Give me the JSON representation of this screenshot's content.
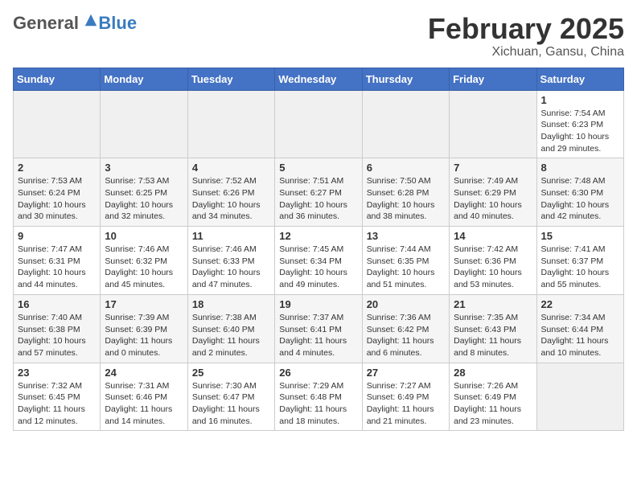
{
  "header": {
    "logo_general": "General",
    "logo_blue": "Blue",
    "month_title": "February 2025",
    "subtitle": "Xichuan, Gansu, China"
  },
  "days_of_week": [
    "Sunday",
    "Monday",
    "Tuesday",
    "Wednesday",
    "Thursday",
    "Friday",
    "Saturday"
  ],
  "weeks": [
    [
      {
        "day": "",
        "empty": true
      },
      {
        "day": "",
        "empty": true
      },
      {
        "day": "",
        "empty": true
      },
      {
        "day": "",
        "empty": true
      },
      {
        "day": "",
        "empty": true
      },
      {
        "day": "",
        "empty": true
      },
      {
        "day": "1",
        "sunrise": "7:54 AM",
        "sunset": "6:23 PM",
        "daylight": "10 hours and 29 minutes."
      }
    ],
    [
      {
        "day": "2",
        "sunrise": "7:53 AM",
        "sunset": "6:24 PM",
        "daylight": "10 hours and 30 minutes."
      },
      {
        "day": "3",
        "sunrise": "7:53 AM",
        "sunset": "6:25 PM",
        "daylight": "10 hours and 32 minutes."
      },
      {
        "day": "4",
        "sunrise": "7:52 AM",
        "sunset": "6:26 PM",
        "daylight": "10 hours and 34 minutes."
      },
      {
        "day": "5",
        "sunrise": "7:51 AM",
        "sunset": "6:27 PM",
        "daylight": "10 hours and 36 minutes."
      },
      {
        "day": "6",
        "sunrise": "7:50 AM",
        "sunset": "6:28 PM",
        "daylight": "10 hours and 38 minutes."
      },
      {
        "day": "7",
        "sunrise": "7:49 AM",
        "sunset": "6:29 PM",
        "daylight": "10 hours and 40 minutes."
      },
      {
        "day": "8",
        "sunrise": "7:48 AM",
        "sunset": "6:30 PM",
        "daylight": "10 hours and 42 minutes."
      }
    ],
    [
      {
        "day": "9",
        "sunrise": "7:47 AM",
        "sunset": "6:31 PM",
        "daylight": "10 hours and 44 minutes."
      },
      {
        "day": "10",
        "sunrise": "7:46 AM",
        "sunset": "6:32 PM",
        "daylight": "10 hours and 45 minutes."
      },
      {
        "day": "11",
        "sunrise": "7:46 AM",
        "sunset": "6:33 PM",
        "daylight": "10 hours and 47 minutes."
      },
      {
        "day": "12",
        "sunrise": "7:45 AM",
        "sunset": "6:34 PM",
        "daylight": "10 hours and 49 minutes."
      },
      {
        "day": "13",
        "sunrise": "7:44 AM",
        "sunset": "6:35 PM",
        "daylight": "10 hours and 51 minutes."
      },
      {
        "day": "14",
        "sunrise": "7:42 AM",
        "sunset": "6:36 PM",
        "daylight": "10 hours and 53 minutes."
      },
      {
        "day": "15",
        "sunrise": "7:41 AM",
        "sunset": "6:37 PM",
        "daylight": "10 hours and 55 minutes."
      }
    ],
    [
      {
        "day": "16",
        "sunrise": "7:40 AM",
        "sunset": "6:38 PM",
        "daylight": "10 hours and 57 minutes."
      },
      {
        "day": "17",
        "sunrise": "7:39 AM",
        "sunset": "6:39 PM",
        "daylight": "11 hours and 0 minutes."
      },
      {
        "day": "18",
        "sunrise": "7:38 AM",
        "sunset": "6:40 PM",
        "daylight": "11 hours and 2 minutes."
      },
      {
        "day": "19",
        "sunrise": "7:37 AM",
        "sunset": "6:41 PM",
        "daylight": "11 hours and 4 minutes."
      },
      {
        "day": "20",
        "sunrise": "7:36 AM",
        "sunset": "6:42 PM",
        "daylight": "11 hours and 6 minutes."
      },
      {
        "day": "21",
        "sunrise": "7:35 AM",
        "sunset": "6:43 PM",
        "daylight": "11 hours and 8 minutes."
      },
      {
        "day": "22",
        "sunrise": "7:34 AM",
        "sunset": "6:44 PM",
        "daylight": "11 hours and 10 minutes."
      }
    ],
    [
      {
        "day": "23",
        "sunrise": "7:32 AM",
        "sunset": "6:45 PM",
        "daylight": "11 hours and 12 minutes."
      },
      {
        "day": "24",
        "sunrise": "7:31 AM",
        "sunset": "6:46 PM",
        "daylight": "11 hours and 14 minutes."
      },
      {
        "day": "25",
        "sunrise": "7:30 AM",
        "sunset": "6:47 PM",
        "daylight": "11 hours and 16 minutes."
      },
      {
        "day": "26",
        "sunrise": "7:29 AM",
        "sunset": "6:48 PM",
        "daylight": "11 hours and 18 minutes."
      },
      {
        "day": "27",
        "sunrise": "7:27 AM",
        "sunset": "6:49 PM",
        "daylight": "11 hours and 21 minutes."
      },
      {
        "day": "28",
        "sunrise": "7:26 AM",
        "sunset": "6:49 PM",
        "daylight": "11 hours and 23 minutes."
      },
      {
        "day": "",
        "empty": true
      }
    ]
  ]
}
